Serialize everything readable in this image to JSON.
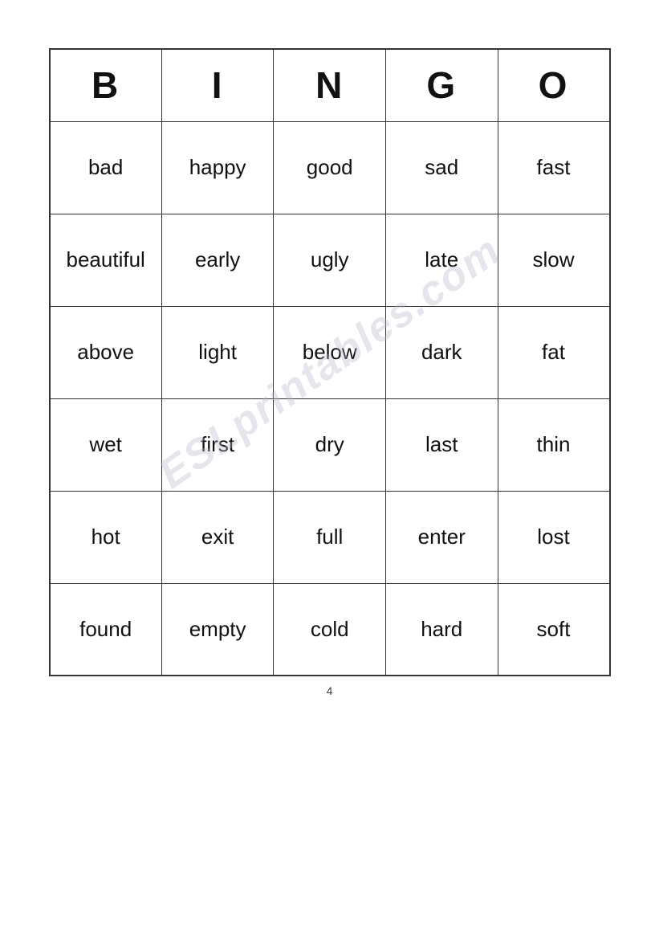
{
  "page": {
    "number": "4",
    "watermark": "ESLprintables.com"
  },
  "header": {
    "cols": [
      "B",
      "I",
      "N",
      "G",
      "O"
    ]
  },
  "rows": [
    [
      "bad",
      "happy",
      "good",
      "sad",
      "fast"
    ],
    [
      "beautiful",
      "early",
      "ugly",
      "late",
      "slow"
    ],
    [
      "above",
      "light",
      "below",
      "dark",
      "fat"
    ],
    [
      "wet",
      "first",
      "dry",
      "last",
      "thin"
    ],
    [
      "hot",
      "exit",
      "full",
      "enter",
      "lost"
    ],
    [
      "found",
      "empty",
      "cold",
      "hard",
      "soft"
    ]
  ]
}
